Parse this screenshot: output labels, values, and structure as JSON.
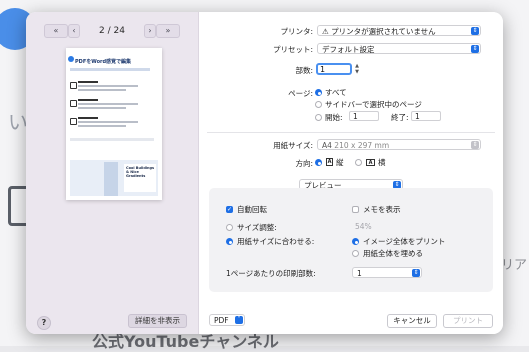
{
  "background": {
    "text_left": "い",
    "text_right": "リア",
    "text_bottom": "公式YouTubeチャンネル"
  },
  "nav": {
    "first": "«",
    "prev": "‹",
    "page_indicator": "2 / 24",
    "next": "›",
    "last": "»"
  },
  "preview": {
    "title": "PDFをWord感覚で編集",
    "card_text": "Cool Buildings & Nice Gradients"
  },
  "left_footer": {
    "help": "?",
    "hide_details": "詳細を非表示"
  },
  "settings": {
    "printer_label": "プリンタ:",
    "printer_value": "プリンタが選択されていません",
    "preset_label": "プリセット:",
    "preset_value": "デフォルト設定",
    "copies_label": "部数:",
    "copies_value": "1",
    "pages_label": "ページ:",
    "pages_all": "すべて",
    "pages_sidebar": "サイドバーで選択中のページ",
    "pages_from_label": "開始:",
    "pages_from_value": "1",
    "pages_to_label": "終了:",
    "pages_to_value": "1",
    "paper_label": "用紙サイズ:",
    "paper_value": "A4",
    "paper_dims": "210 x 297 mm",
    "orientation_label": "方向:",
    "portrait": "縦",
    "landscape": "横"
  },
  "panel": {
    "mode_select": "プレビュー",
    "auto_rotate": "自動回転",
    "show_notes": "メモを表示",
    "scale_label": "サイズ調整:",
    "scale_value": "54%",
    "fit_label": "用紙サイズに合わせる:",
    "print_entire": "イメージ全体をプリント",
    "fill_paper": "用紙全体を埋める",
    "pages_per_sheet_label": "1ページあたりの印刷部数:",
    "pages_per_sheet_value": "1"
  },
  "footer": {
    "pdf": "PDF",
    "cancel": "キャンセル",
    "print": "プリント"
  },
  "colors": {
    "accent": "#1e6fe5",
    "sidebar_bg": "#ebe6ee"
  }
}
